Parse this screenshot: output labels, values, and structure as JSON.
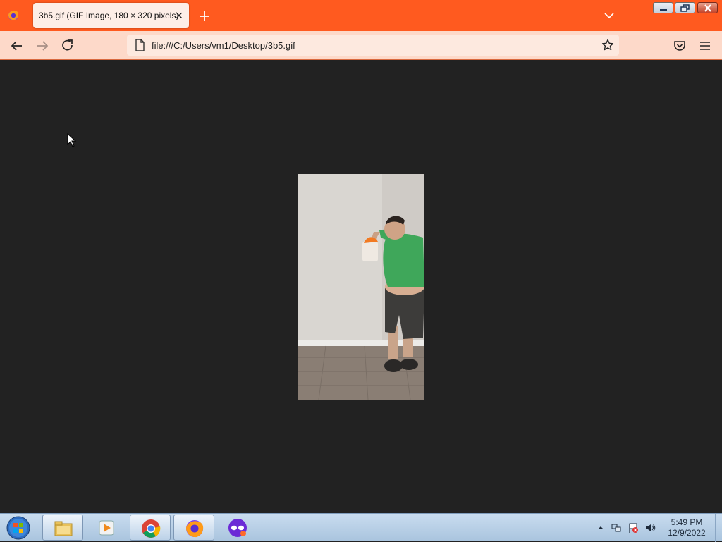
{
  "browser": {
    "tab": {
      "title": "3b5.gif (GIF Image, 180 × 320 pixels)",
      "close_glyph": "✕"
    },
    "url": "file:///C:/Users/vm1/Desktop/3b5.gif",
    "icons": {
      "app": "firefox-icon",
      "new_tab": "plus-icon",
      "list_tabs": "chevron-down-icon",
      "back": "arrow-left-icon",
      "forward": "arrow-right-icon",
      "reload": "reload-icon",
      "page": "page-icon",
      "bookmark": "star-icon",
      "pocket": "pocket-icon",
      "menu": "hamburger-icon"
    },
    "colors": {
      "titlebar": "#ff5a1f",
      "navbar": "#fdd9c9",
      "content_bg": "#222222"
    }
  },
  "content": {
    "image": {
      "description_icon": "gif-image",
      "width_px_label": "180",
      "height_px_label": "320"
    }
  },
  "taskbar": {
    "apps": [
      "file-explorer-icon",
      "media-player-icon",
      "chrome-icon",
      "firefox-icon",
      "incognito-mask-icon"
    ],
    "tray_icons": [
      "tray-up-arrow-icon",
      "network-icon",
      "flag-icon",
      "volume-icon"
    ],
    "time": "5:49 PM",
    "date": "12/9/2022"
  }
}
